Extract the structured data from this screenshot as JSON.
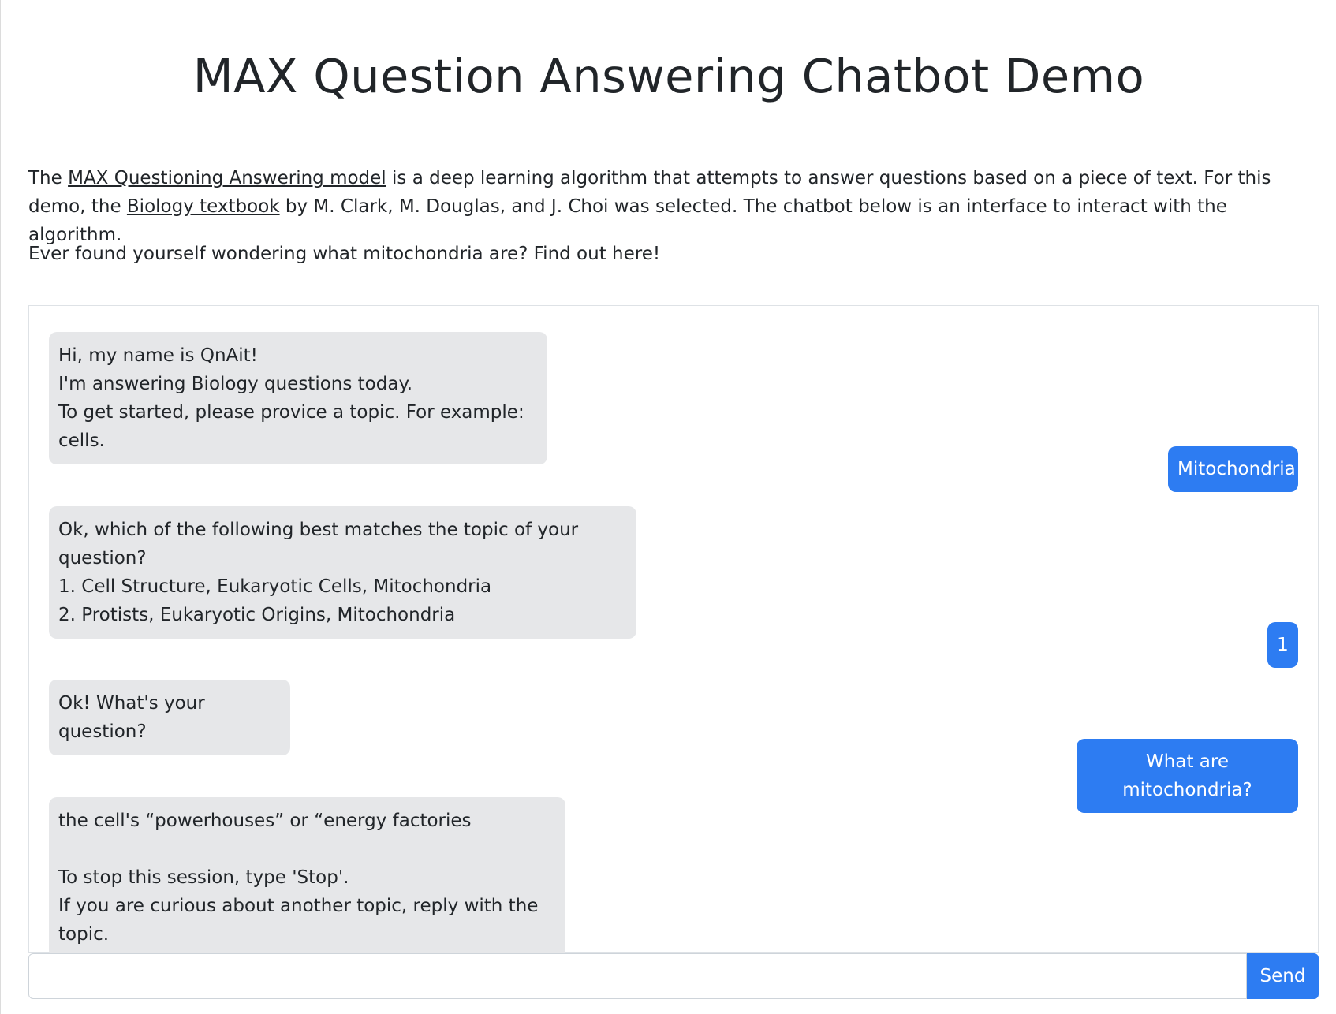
{
  "title": "MAX Question Answering Chatbot Demo",
  "intro": {
    "p1_prefix": "The ",
    "model_link": "MAX Questioning Answering model",
    "p1_middle": " is a deep learning algorithm that attempts to answer questions based on a piece of text. For this demo, the ",
    "textbook_link": "Biology textbook",
    "p1_suffix": " by M. Clark, M. Douglas, and J. Choi was selected. The chatbot below is an interface to interact with the algorithm.",
    "p2": "Ever found yourself wondering what mitochondria are? Find out here!"
  },
  "chat": {
    "messages": [
      {
        "sender": "bot",
        "text": "Hi, my name is QnAit!\nI'm answering Biology questions today.\nTo get started, please provice a topic. For example: cells."
      },
      {
        "sender": "user",
        "text": "Mitochondria"
      },
      {
        "sender": "bot",
        "text": "Ok, which of the following best matches the topic of your question?\n1. Cell Structure, Eukaryotic Cells, Mitochondria\n2. Protists, Eukaryotic Origins, Mitochondria"
      },
      {
        "sender": "user",
        "text": "1"
      },
      {
        "sender": "bot",
        "text": "Ok! What's your question?"
      },
      {
        "sender": "user",
        "text": "What are mitochondria?"
      },
      {
        "sender": "bot",
        "text": "the cell's “powerhouses” or “energy factories\n\nTo stop this session, type 'Stop'.\nIf you are curious about another topic, reply with the topic."
      }
    ]
  },
  "input": {
    "value": "",
    "placeholder": ""
  },
  "send_label": "Send",
  "colors": {
    "user_bubble": "#2d7cf2",
    "bot_bubble": "#e6e7e9",
    "text": "#212529"
  }
}
